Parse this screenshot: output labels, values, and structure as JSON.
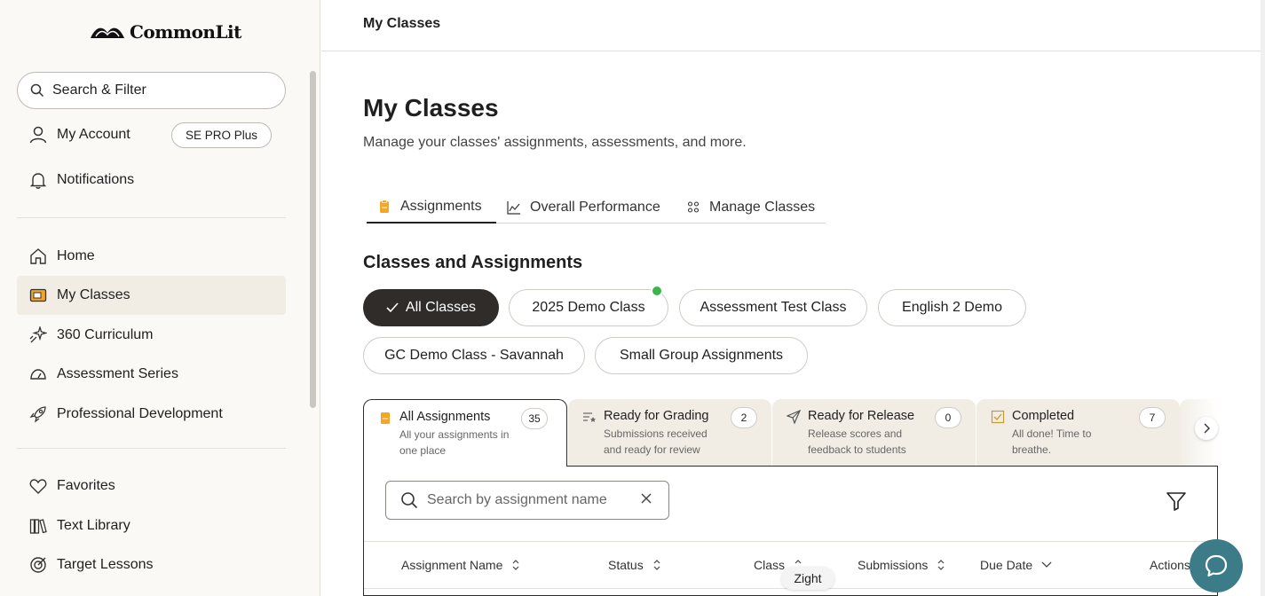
{
  "brand": {
    "name": "CommonLit"
  },
  "sidebar": {
    "search_label": "Search & Filter",
    "account_label": "My Account",
    "account_badge": "SE PRO Plus",
    "notifications_label": "Notifications",
    "items": [
      {
        "label": "Home",
        "icon": "home-icon"
      },
      {
        "label": "My Classes",
        "icon": "classes-icon"
      },
      {
        "label": "360 Curriculum",
        "icon": "sparkle-icon"
      },
      {
        "label": "Assessment Series",
        "icon": "gauge-icon"
      },
      {
        "label": "Professional Development",
        "icon": "rocket-icon"
      }
    ],
    "items2": [
      {
        "label": "Favorites",
        "icon": "heart-icon"
      },
      {
        "label": "Text Library",
        "icon": "books-icon"
      },
      {
        "label": "Target Lessons",
        "icon": "target-icon"
      }
    ]
  },
  "topbar": {
    "title": "My Classes"
  },
  "main": {
    "title": "My Classes",
    "subtitle": "Manage your classes' assignments, assessments, and more.",
    "tabs": [
      {
        "label": "Assignments"
      },
      {
        "label": "Overall Performance"
      },
      {
        "label": "Manage Classes"
      }
    ],
    "section_title": "Classes and Assignments",
    "class_chips": [
      "All Classes",
      "2025 Demo Class",
      "Assessment Test Class",
      "English 2 Demo",
      "GC Demo Class - Savannah",
      "Small Group Assignments"
    ],
    "cards": [
      {
        "title": "All Assignments",
        "desc": "All your assignments in one place",
        "count": "35"
      },
      {
        "title": "Ready for Grading",
        "desc": "Submissions received and ready for review",
        "count": "2"
      },
      {
        "title": "Ready for Release",
        "desc": "Release scores and feedback to students",
        "count": "0"
      },
      {
        "title": "Completed",
        "desc": "All done! Time to breathe.",
        "count": "7"
      }
    ],
    "search": {
      "placeholder": "Search by assignment name"
    },
    "columns": [
      "Assignment Name",
      "Status",
      "Class",
      "Submissions",
      "Due Date",
      "Actions"
    ],
    "tooltip": "Zight"
  },
  "colors": {
    "accent": "#f5a623",
    "selected_chip": "#2f2c2a",
    "help": "#3b7c88",
    "online": "#3cb54a"
  }
}
